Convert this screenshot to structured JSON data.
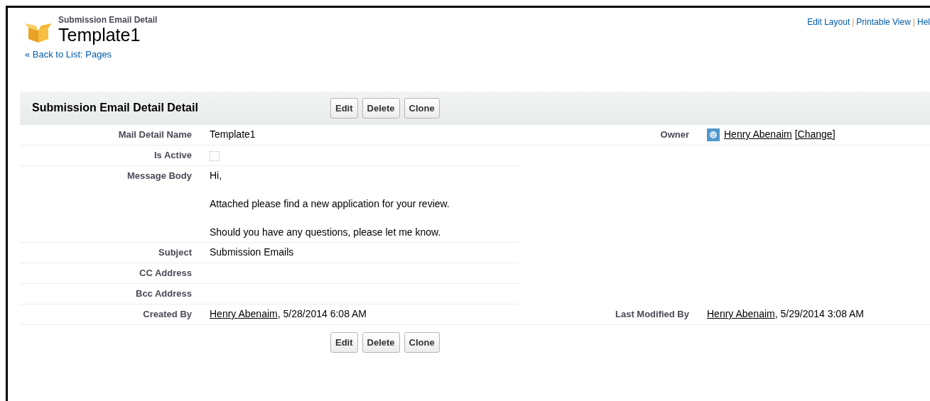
{
  "header": {
    "object_type": "Submission Email Detail",
    "title": "Template1",
    "back_link": "« Back to List: Pages"
  },
  "top_links": {
    "separator": "|",
    "items": [
      "Edit Layout",
      "Printable View",
      "Hel"
    ]
  },
  "section": {
    "title": "Submission Email Detail Detail",
    "buttons": [
      "Edit",
      "Delete",
      "Clone"
    ]
  },
  "rows": [
    {
      "label": "Mail Detail Name",
      "kind": "text",
      "text": "Template1",
      "right": {
        "label": "Owner",
        "kind": "owner",
        "link": "Henry Abenaim",
        "action": "[Change]"
      }
    },
    {
      "label": "Is Active",
      "kind": "checkbox",
      "checked": false
    },
    {
      "label": "Message Body",
      "kind": "paragraphs",
      "lines": [
        "Hi,",
        "Attached please find a new application for your review.",
        "Should you have any questions, please let me know."
      ]
    },
    {
      "label": "Subject",
      "kind": "text",
      "text": "Submission Emails"
    },
    {
      "label": "CC Address",
      "kind": "empty"
    },
    {
      "label": "Bcc Address",
      "kind": "empty"
    },
    {
      "label": "Created By",
      "kind": "user",
      "link": "Henry Abenaim",
      "text": ", 5/28/2014 6:08 AM",
      "right": {
        "label": "Last Modified By",
        "kind": "user",
        "link": "Henry Abenaim",
        "text": ", 5/29/2014 3:08 AM"
      }
    }
  ],
  "bottom_buttons": [
    "Edit",
    "Delete",
    "Clone"
  ]
}
